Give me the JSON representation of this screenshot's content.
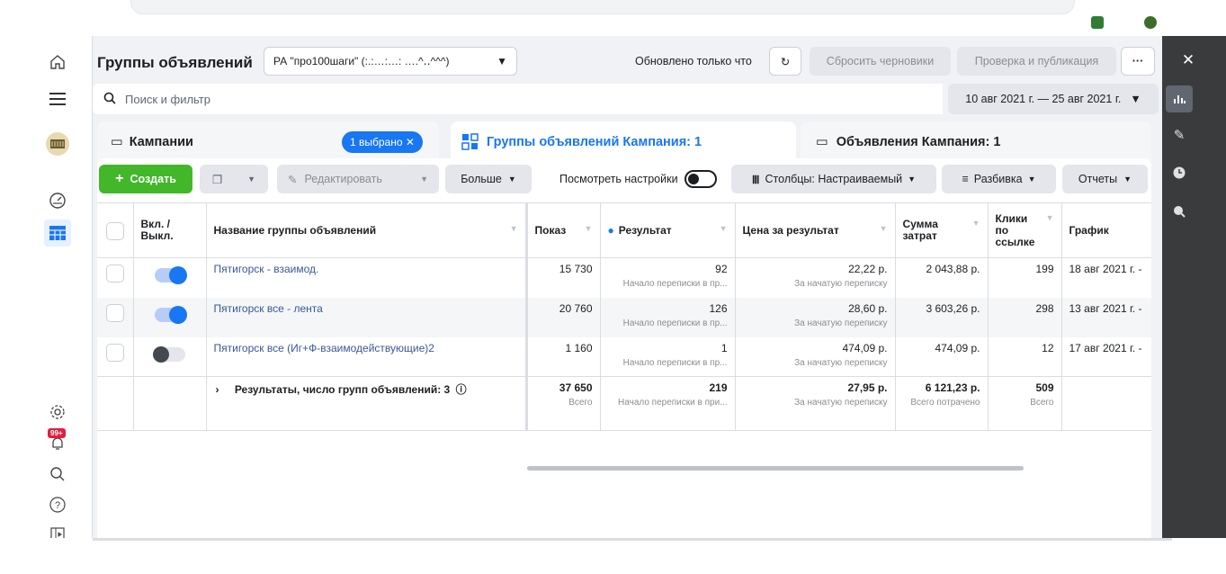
{
  "colors": {
    "accent": "#1877f2",
    "create_green": "#42b72a",
    "link": "#385898",
    "right_bar": "#3a3b3c"
  },
  "header": {
    "title": "Группы объявлений",
    "campaign_select": "РА \"про100шаги\" (:.:…:…: ….^‥^^^)",
    "updated": "Обновлено только что",
    "reset_drafts": "Сбросить черновики",
    "publish": "Проверка и публикация",
    "more": "···"
  },
  "search": {
    "placeholder": "Поиск и фильтр"
  },
  "date_range": "10 авг 2021 г. — 25 авг 2021 г.",
  "tabs": {
    "campaigns": "Кампании",
    "selected_badge": "1 выбрано",
    "adsets": "Группы объявлений Кампания: 1",
    "ads": "Объявления Кампания: 1"
  },
  "toolbar": {
    "create": "Создать",
    "edit": "Редактировать",
    "more": "Больше",
    "view_settings": "Посмотреть настройки",
    "columns": "Столбцы: Настраиваемый",
    "breakdown": "Разбивка",
    "reports": "Отчеты"
  },
  "table": {
    "headers": {
      "onoff": "Вкл. / Выкл.",
      "name": "Название группы объявлений",
      "impressions": "Показ",
      "result": "Результат",
      "cost": "Цена за результат",
      "spend": "Сумма затрат",
      "clicks": "Клики по ссылке",
      "schedule": "График"
    },
    "rows": [
      {
        "name": "Пятигорск - взаимод.",
        "on": true,
        "impressions": "15 730",
        "result": "92",
        "result_sub": "Начало переписки в пр...",
        "cost": "22,22 р.",
        "cost_sub": "За начатую переписку",
        "spend": "2 043,88 р.",
        "clicks": "199",
        "schedule": "18 авг 2021 г. -"
      },
      {
        "name": "Пятигорск все - лента",
        "on": true,
        "impressions": "20 760",
        "result": "126",
        "result_sub": "Начало переписки в пр...",
        "cost": "28,60 р.",
        "cost_sub": "За начатую переписку",
        "spend": "3 603,26 р.",
        "clicks": "298",
        "schedule": "13 авг 2021 г. -"
      },
      {
        "name": "Пятигорск все (Иг+Ф-взаимодействующие)2",
        "on": false,
        "impressions": "1 160",
        "result": "1",
        "result_sub": "Начало переписки в пр...",
        "cost": "474,09 р.",
        "cost_sub": "За начатую переписку",
        "spend": "474,09 р.",
        "clicks": "12",
        "schedule": "17 авг 2021 г. -"
      }
    ],
    "totals": {
      "label": "Результаты, число групп объявлений: 3",
      "impressions": "37 650",
      "impressions_sub": "Всего",
      "result": "219",
      "result_sub": "Начало переписки в при...",
      "cost": "27,95 р.",
      "cost_sub": "За начатую переписку",
      "spend": "6 121,23 р.",
      "spend_sub": "Всего потрачено",
      "clicks": "509",
      "clicks_sub": "Всего"
    }
  },
  "left_nav": {
    "notifications_badge": "99+"
  }
}
